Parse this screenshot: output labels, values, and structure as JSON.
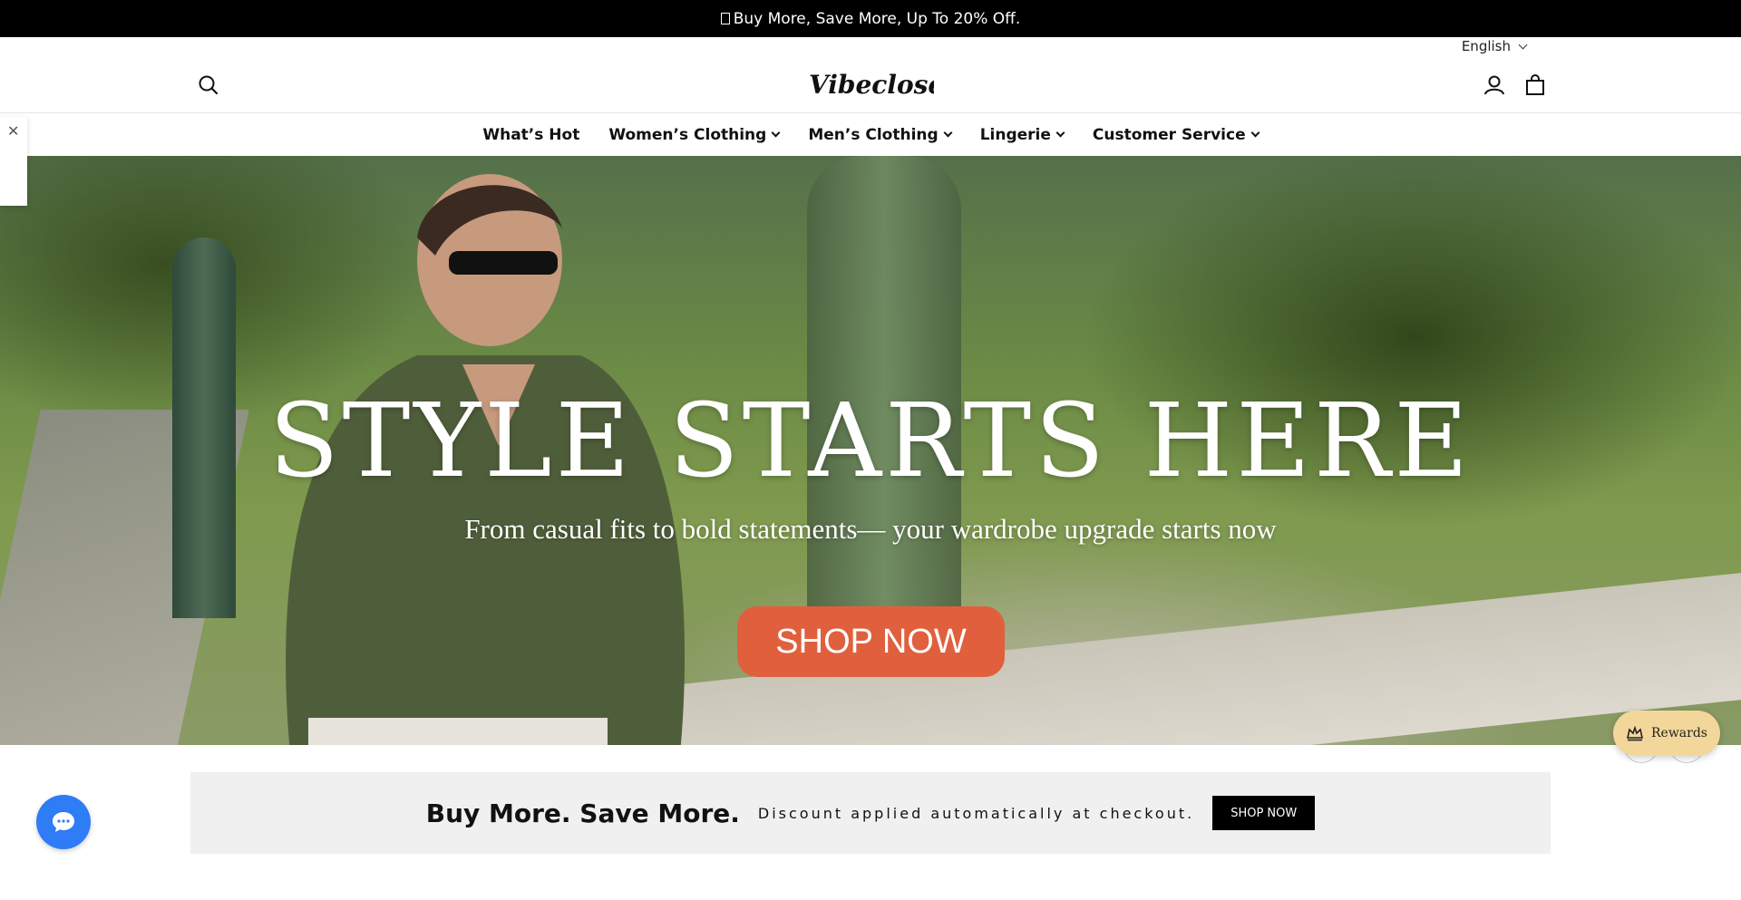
{
  "announcement": {
    "text": "Buy More, Save More, Up To 20% Off."
  },
  "header": {
    "language": "English",
    "logo_text": "Vibecloset",
    "icons": [
      "search-icon",
      "account-icon",
      "cart-icon"
    ]
  },
  "nav": {
    "items": [
      {
        "label": "What’s Hot",
        "has_dropdown": false
      },
      {
        "label": "Women’s Clothing",
        "has_dropdown": true
      },
      {
        "label": "Men’s Clothing",
        "has_dropdown": true
      },
      {
        "label": "Lingerie",
        "has_dropdown": true
      },
      {
        "label": "Customer Service",
        "has_dropdown": true
      }
    ]
  },
  "hero": {
    "title": "STYLE STARTS HERE",
    "subtitle": "From casual fits to bold statements— your wardrobe upgrade starts now",
    "button_label": "SHOP NOW",
    "button_color": "#e0603e"
  },
  "rewards": {
    "label": "Rewards"
  },
  "promo": {
    "title": "Buy More. Save More.",
    "text": "Discount applied automatically at checkout.",
    "button_label": "SHOP NOW"
  },
  "colors": {
    "announcement_bg": "#000000",
    "chat_bubble": "#2e7cf6",
    "rewards_bg": "#f3d79a"
  }
}
